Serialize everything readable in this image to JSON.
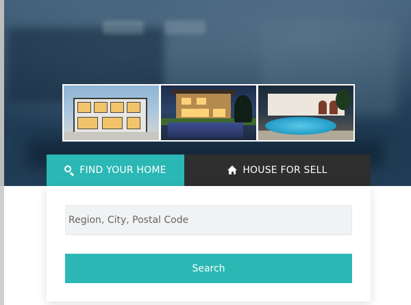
{
  "gallery": {
    "images": [
      {
        "alt_icon": "modern-house-photo"
      },
      {
        "alt_icon": "night-house-pool-photo"
      },
      {
        "alt_icon": "villa-pool-photo"
      }
    ]
  },
  "tabs": [
    {
      "label": "FIND YOUR HOME",
      "icon": "search-icon",
      "active": true
    },
    {
      "label": "HOUSE FOR SELL",
      "icon": "home-icon",
      "active": false
    }
  ],
  "search": {
    "placeholder": "Region, City, Postal Code",
    "value": "",
    "button_label": "Search"
  },
  "colors": {
    "accent": "#2bb8b5",
    "tab_dark": "#2e2e2e",
    "input_bg": "#f1f2f3"
  }
}
